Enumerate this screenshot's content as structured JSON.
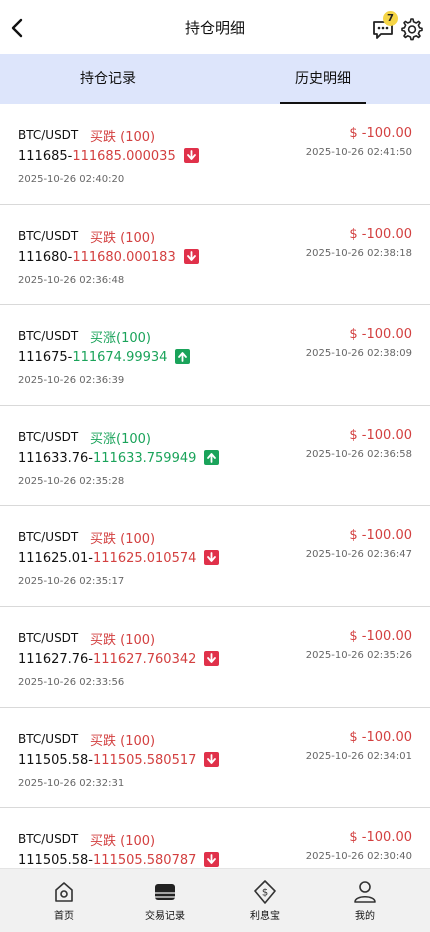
{
  "header": {
    "title": "持仓明细",
    "badge_count": "7"
  },
  "tabs": [
    {
      "label": "持仓记录",
      "active": false
    },
    {
      "label": "历史明细",
      "active": true
    }
  ],
  "orders": [
    {
      "pair": "BTC/USDT",
      "side": "买跌 (100)",
      "direction": "down",
      "open_price": "111685-",
      "close_price": "111685.000035",
      "amount": "$ -100.00",
      "close_time": "2025-10-26 02:41:50",
      "open_time": "2025-10-26 02:40:20"
    },
    {
      "pair": "BTC/USDT",
      "side": "买跌 (100)",
      "direction": "down",
      "open_price": "111680-",
      "close_price": "111680.000183",
      "amount": "$ -100.00",
      "close_time": "2025-10-26 02:38:18",
      "open_time": "2025-10-26 02:36:48"
    },
    {
      "pair": "BTC/USDT",
      "side": "买涨(100)",
      "direction": "up",
      "open_price": "111675-",
      "close_price": "111674.99934",
      "amount": "$ -100.00",
      "close_time": "2025-10-26 02:38:09",
      "open_time": "2025-10-26 02:36:39"
    },
    {
      "pair": "BTC/USDT",
      "side": "买涨(100)",
      "direction": "up",
      "open_price": "111633.76-",
      "close_price": "111633.759949",
      "amount": "$ -100.00",
      "close_time": "2025-10-26 02:36:58",
      "open_time": "2025-10-26 02:35:28"
    },
    {
      "pair": "BTC/USDT",
      "side": "买跌 (100)",
      "direction": "down",
      "open_price": "111625.01-",
      "close_price": "111625.010574",
      "amount": "$ -100.00",
      "close_time": "2025-10-26 02:36:47",
      "open_time": "2025-10-26 02:35:17"
    },
    {
      "pair": "BTC/USDT",
      "side": "买跌 (100)",
      "direction": "down",
      "open_price": "111627.76-",
      "close_price": "111627.760342",
      "amount": "$ -100.00",
      "close_time": "2025-10-26 02:35:26",
      "open_time": "2025-10-26 02:33:56"
    },
    {
      "pair": "BTC/USDT",
      "side": "买跌 (100)",
      "direction": "down",
      "open_price": "111505.58-",
      "close_price": "111505.580517",
      "amount": "$ -100.00",
      "close_time": "2025-10-26 02:34:01",
      "open_time": "2025-10-26 02:32:31"
    },
    {
      "pair": "BTC/USDT",
      "side": "买跌 (100)",
      "direction": "down",
      "open_price": "111505.58-",
      "close_price": "111505.580787",
      "amount": "$ -100.00",
      "close_time": "2025-10-26 02:30:40",
      "open_time": ""
    }
  ],
  "bottom_nav": [
    {
      "label": "首页",
      "icon": "home-icon"
    },
    {
      "label": "交易记录",
      "icon": "records-icon"
    },
    {
      "label": "利息宝",
      "icon": "interest-icon"
    },
    {
      "label": "我的",
      "icon": "profile-icon"
    }
  ],
  "colors": {
    "up": "#1aa35a",
    "down": "#d34040",
    "tab_bg": "#dde5fb"
  }
}
